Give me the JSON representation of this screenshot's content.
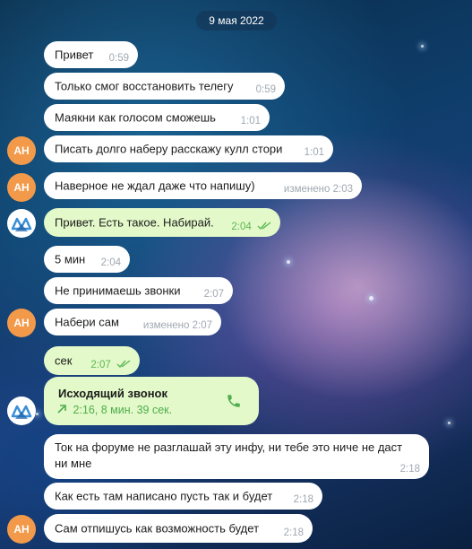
{
  "date_label": "9 мая 2022",
  "messages": [
    {
      "text": "Привет",
      "time": "0:59"
    },
    {
      "text": "Только смог восстановить телегу",
      "time": "0:59"
    },
    {
      "text": "Маякни как голосом сможешь",
      "time": "1:01"
    },
    {
      "text": "Писать долго наберу расскажу кулл стори",
      "time": "1:01"
    },
    {
      "text": "Наверное не ждал даже что напишу)",
      "time": "изменено 2:03"
    },
    {
      "text": "Привет. Есть такое. Набирай.",
      "time": "2:04"
    },
    {
      "text": "5 мин",
      "time": "2:04"
    },
    {
      "text": "Не принимаешь звонки",
      "time": "2:07"
    },
    {
      "text": "Набери сам",
      "time": "изменено 2:07"
    },
    {
      "text": "сек",
      "time": "2:07"
    },
    {
      "text": "Ток на форуме не разглашай эту инфу, ни тебе это ниче не даст ни мне",
      "time": "2:18"
    },
    {
      "text": "Как есть там написано пусть так и будет",
      "time": "2:18"
    },
    {
      "text": "Сам отпишусь как возможность будет",
      "time": "2:18"
    }
  ],
  "call": {
    "title": "Исходящий звонок",
    "details": "2:16, 8 мин. 39 сек."
  },
  "avatar_initials": "АН",
  "colors": {
    "avatar_ah": "#f29a4a",
    "outgoing_bubble": "#e3f9c9",
    "incoming_bubble": "#ffffff",
    "accent_green": "#4fae4e"
  }
}
